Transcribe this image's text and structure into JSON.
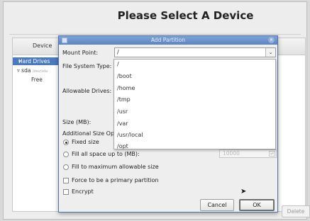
{
  "window": {
    "title": "Please Select A Device"
  },
  "device_panel": {
    "column_header": "Device",
    "tree": [
      {
        "label": "Hard Drives",
        "selected": true
      },
      {
        "label": "sda",
        "sublabel": "/dev/sda"
      },
      {
        "label": "Free"
      }
    ],
    "delete_label": "Delete"
  },
  "dialog": {
    "title": "Add Partition",
    "mount_point": {
      "label": "Mount Point:",
      "value": "/",
      "options": [
        "/",
        "/boot",
        "/home",
        "/tmp",
        "/usr",
        "/var",
        "/usr/local",
        "/opt"
      ]
    },
    "file_system_type_label": "File System Type:",
    "allowable_drives_label": "Allowable Drives:",
    "size_label": "Size (MB):",
    "additional_size_label": "Additional Size Op",
    "size_options": [
      {
        "label": "Fixed size",
        "selected": true
      },
      {
        "label": "Fill all space up to (MB):",
        "selected": false
      },
      {
        "label": "Fill to maximum allowable size",
        "selected": false
      }
    ],
    "fill_up_to_value": "10000",
    "primary_partition_label": "Force to be a primary partition",
    "encrypt_label": "Encrypt",
    "cancel_label": "Cancel",
    "ok_label": "OK"
  },
  "colors": {
    "accent": "#5b85c2",
    "selection": "#4a7ac0"
  }
}
